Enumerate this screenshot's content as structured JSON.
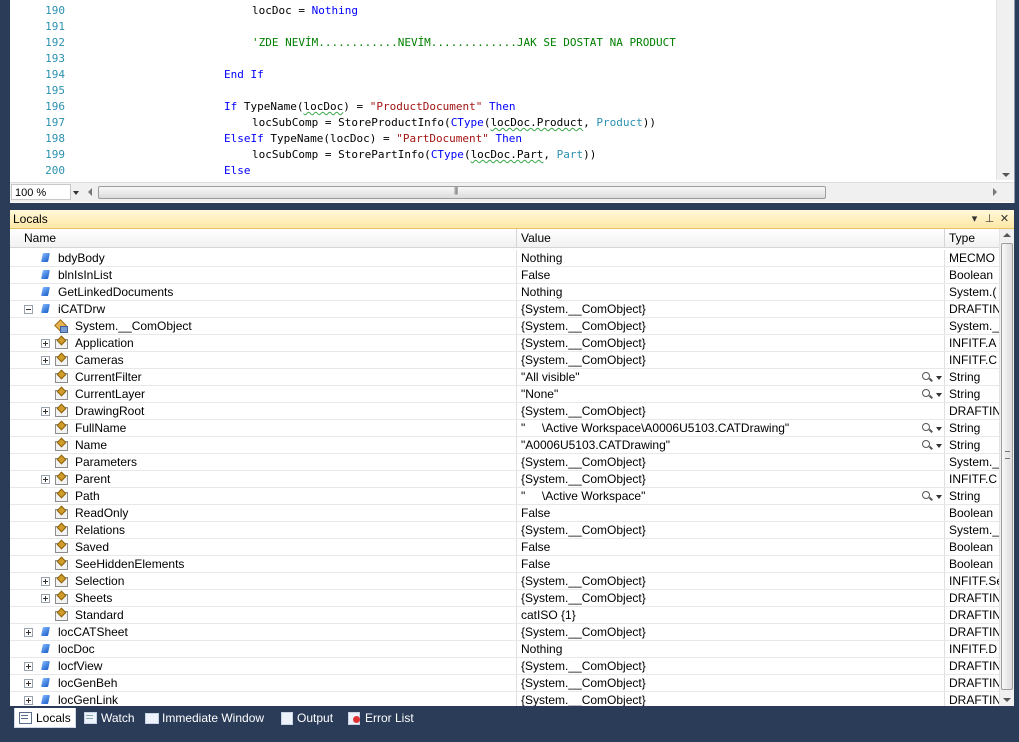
{
  "editor": {
    "zoom": "100 %",
    "lines": [
      {
        "no": "190",
        "indent": 8,
        "parts": [
          {
            "t": "locDoc = ",
            "c": ""
          },
          {
            "t": "Nothing",
            "c": "kw"
          }
        ]
      },
      {
        "no": "191",
        "indent": 0,
        "parts": []
      },
      {
        "no": "192",
        "indent": 8,
        "parts": [
          {
            "t": "'ZDE NEVÍM............NEVÍM.............JAK SE DOSTAT NA PRODUCT",
            "c": "cmt"
          }
        ]
      },
      {
        "no": "193",
        "indent": 0,
        "parts": []
      },
      {
        "no": "194",
        "indent": 4,
        "parts": [
          {
            "t": "End If",
            "c": "kw"
          }
        ]
      },
      {
        "no": "195",
        "indent": 0,
        "parts": []
      },
      {
        "no": "196",
        "indent": 4,
        "parts": [
          {
            "t": "If",
            "c": "kw"
          },
          {
            "t": " TypeName(",
            "c": ""
          },
          {
            "t": "locDoc",
            "c": "squig"
          },
          {
            "t": ") = ",
            "c": ""
          },
          {
            "t": "\"ProductDocument\"",
            "c": "str"
          },
          {
            "t": " ",
            "c": ""
          },
          {
            "t": "Then",
            "c": "kw"
          }
        ]
      },
      {
        "no": "197",
        "indent": 8,
        "parts": [
          {
            "t": "locSubComp = StoreProductInfo(",
            "c": ""
          },
          {
            "t": "CType",
            "c": "kw"
          },
          {
            "t": "(",
            "c": ""
          },
          {
            "t": "locDoc.Product",
            "c": "squig"
          },
          {
            "t": ", ",
            "c": ""
          },
          {
            "t": "Product",
            "c": "typ"
          },
          {
            "t": "))",
            "c": ""
          }
        ]
      },
      {
        "no": "198",
        "indent": 4,
        "parts": [
          {
            "t": "ElseIf",
            "c": "kw"
          },
          {
            "t": " TypeName(locDoc) = ",
            "c": ""
          },
          {
            "t": "\"PartDocument\"",
            "c": "str"
          },
          {
            "t": " ",
            "c": ""
          },
          {
            "t": "Then",
            "c": "kw"
          }
        ]
      },
      {
        "no": "199",
        "indent": 8,
        "parts": [
          {
            "t": "locSubComp = StorePartInfo(",
            "c": ""
          },
          {
            "t": "CType",
            "c": "kw"
          },
          {
            "t": "(",
            "c": ""
          },
          {
            "t": "locDoc.Part",
            "c": "squig"
          },
          {
            "t": ", ",
            "c": ""
          },
          {
            "t": "Part",
            "c": "typ"
          },
          {
            "t": "))",
            "c": ""
          }
        ]
      },
      {
        "no": "200",
        "indent": 4,
        "parts": [
          {
            "t": "Else",
            "c": "kw"
          }
        ]
      }
    ]
  },
  "locals": {
    "title": "Locals",
    "columns": {
      "name": "Name",
      "value": "Value",
      "type": "Type"
    },
    "rows": [
      {
        "name": "bdyBody",
        "value": "Nothing",
        "type": "MECMO",
        "level": 0,
        "expander": "",
        "icon": "var",
        "magnifier": false
      },
      {
        "name": "blnIsInList",
        "value": "False",
        "type": "Boolean",
        "level": 0,
        "expander": "",
        "icon": "var",
        "magnifier": false
      },
      {
        "name": "GetLinkedDocuments",
        "value": "Nothing",
        "type": "System.(",
        "level": 0,
        "expander": "",
        "icon": "var",
        "magnifier": false
      },
      {
        "name": "iCATDrw",
        "value": "{System.__ComObject}",
        "type": "DRAFTIN",
        "level": 0,
        "expander": "minus",
        "icon": "var",
        "magnifier": false
      },
      {
        "name": "System.__ComObject",
        "value": "{System.__ComObject}",
        "type": "System._",
        "level": 1,
        "expander": "",
        "icon": "base",
        "magnifier": false
      },
      {
        "name": "Application",
        "value": "{System.__ComObject}",
        "type": "INFITF.A",
        "level": 1,
        "expander": "plus",
        "icon": "prop",
        "magnifier": false
      },
      {
        "name": "Cameras",
        "value": "{System.__ComObject}",
        "type": "INFITF.C",
        "level": 1,
        "expander": "plus",
        "icon": "prop",
        "magnifier": false
      },
      {
        "name": "CurrentFilter",
        "value": "\"All visible\"",
        "type": "String",
        "level": 1,
        "expander": "",
        "icon": "prop",
        "magnifier": true
      },
      {
        "name": "CurrentLayer",
        "value": "\"None\"",
        "type": "String",
        "level": 1,
        "expander": "",
        "icon": "prop",
        "magnifier": true
      },
      {
        "name": "DrawingRoot",
        "value": "{System.__ComObject}",
        "type": "DRAFTIN",
        "level": 1,
        "expander": "plus",
        "icon": "prop",
        "magnifier": false
      },
      {
        "name": "FullName",
        "value": "\"     \\Active Workspace\\A0006U5103.CATDrawing\"",
        "type": "String",
        "level": 1,
        "expander": "",
        "icon": "prop",
        "magnifier": true
      },
      {
        "name": "Name",
        "value": "\"A0006U5103.CATDrawing\"",
        "type": "String",
        "level": 1,
        "expander": "",
        "icon": "prop",
        "magnifier": true
      },
      {
        "name": "Parameters",
        "value": "{System.__ComObject}",
        "type": "System._",
        "level": 1,
        "expander": "",
        "icon": "prop",
        "magnifier": false
      },
      {
        "name": "Parent",
        "value": "{System.__ComObject}",
        "type": "INFITF.C",
        "level": 1,
        "expander": "plus",
        "icon": "prop",
        "magnifier": false
      },
      {
        "name": "Path",
        "value": "\"     \\Active Workspace\"",
        "type": "String",
        "level": 1,
        "expander": "",
        "icon": "prop",
        "magnifier": true
      },
      {
        "name": "ReadOnly",
        "value": "False",
        "type": "Boolean",
        "level": 1,
        "expander": "",
        "icon": "prop",
        "magnifier": false
      },
      {
        "name": "Relations",
        "value": "{System.__ComObject}",
        "type": "System._",
        "level": 1,
        "expander": "",
        "icon": "prop",
        "magnifier": false
      },
      {
        "name": "Saved",
        "value": "False",
        "type": "Boolean",
        "level": 1,
        "expander": "",
        "icon": "prop",
        "magnifier": false
      },
      {
        "name": "SeeHiddenElements",
        "value": "False",
        "type": "Boolean",
        "level": 1,
        "expander": "",
        "icon": "prop",
        "magnifier": false
      },
      {
        "name": "Selection",
        "value": "{System.__ComObject}",
        "type": "INFITF.Se",
        "level": 1,
        "expander": "plus",
        "icon": "prop",
        "magnifier": false
      },
      {
        "name": "Sheets",
        "value": "{System.__ComObject}",
        "type": "DRAFTIN",
        "level": 1,
        "expander": "plus",
        "icon": "prop",
        "magnifier": false
      },
      {
        "name": "Standard",
        "value": "catISO {1}",
        "type": "DRAFTIN",
        "level": 1,
        "expander": "",
        "icon": "prop",
        "magnifier": false
      },
      {
        "name": "locCATSheet",
        "value": "{System.__ComObject}",
        "type": "DRAFTIN",
        "level": 0,
        "expander": "plus",
        "icon": "var",
        "magnifier": false
      },
      {
        "name": "locDoc",
        "value": "Nothing",
        "type": "INFITF.D",
        "level": 0,
        "expander": "",
        "icon": "var",
        "magnifier": false
      },
      {
        "name": "locfView",
        "value": "{System.__ComObject}",
        "type": "DRAFTIN",
        "level": 0,
        "expander": "plus",
        "icon": "var",
        "magnifier": false
      },
      {
        "name": "locGenBeh",
        "value": "{System.__ComObject}",
        "type": "DRAFTIN",
        "level": 0,
        "expander": "plus",
        "icon": "var",
        "magnifier": false
      },
      {
        "name": "locGenLink",
        "value": "{System.__ComObject}",
        "type": "DRAFTIN",
        "level": 0,
        "expander": "plus",
        "icon": "var",
        "magnifier": false
      }
    ]
  },
  "tabs": [
    {
      "label": "Locals",
      "icon": "locals-icon",
      "active": true
    },
    {
      "label": "Watch",
      "icon": "watch-icon",
      "active": false
    },
    {
      "label": "Immediate Window",
      "icon": "immediate-window-icon",
      "active": false
    },
    {
      "label": "Output",
      "icon": "output-icon",
      "active": false
    },
    {
      "label": "Error List",
      "icon": "error-list-icon",
      "active": false
    }
  ]
}
